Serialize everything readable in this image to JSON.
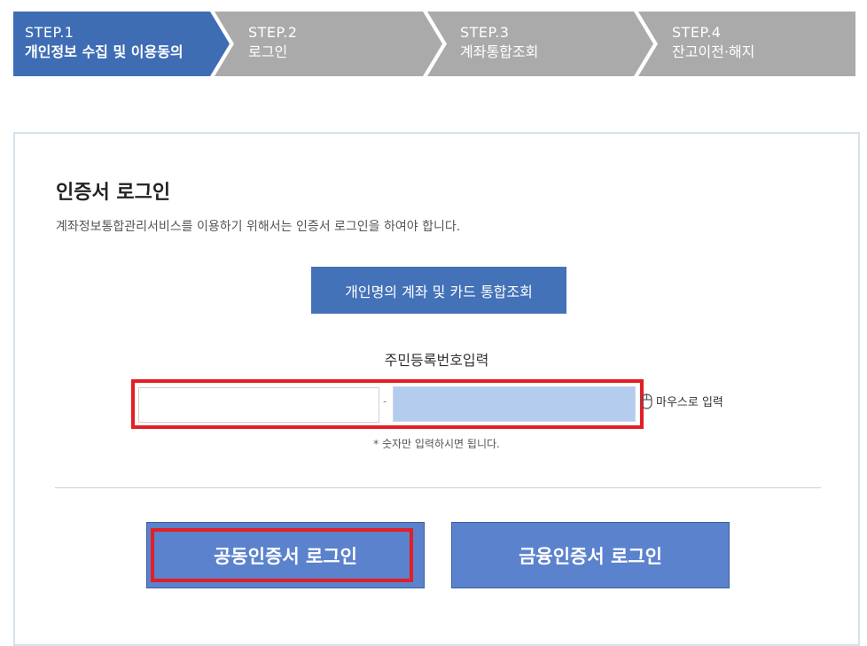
{
  "steps": [
    {
      "num": "STEP.1",
      "label": "개인정보 수집 및 이용동의",
      "active": true
    },
    {
      "num": "STEP.2",
      "label": "로그인",
      "active": false
    },
    {
      "num": "STEP.3",
      "label": "계좌통합조회",
      "active": false
    },
    {
      "num": "STEP.4",
      "label": "잔고이전·해지",
      "active": false
    }
  ],
  "colors": {
    "active_step": "#3f6db4",
    "inactive_step": "#aaaaaa",
    "button_blue": "#5b82cc",
    "highlight_red": "#e21f26",
    "input_focus": "#b4cdee"
  },
  "login": {
    "title": "인증서 로그인",
    "description": "계좌정보통합관리서비스를 이용하기 위해서는 인증서 로그인을 하여야 합니다.",
    "inquiry_button": "개인명의 계좌 및 카드 통합조회",
    "rrn_label": "주민등록번호입력",
    "rrn_first": {
      "value": "",
      "placeholder": ""
    },
    "rrn_separator": "-",
    "rrn_second": {
      "value": "",
      "placeholder": ""
    },
    "mouse_input_label": "마우스로 입력",
    "mouse_icon": "mouse-icon",
    "hint": "* 숫자만 입력하시면 됩니다.",
    "joint_cert_button": "공동인증서 로그인",
    "financial_cert_button": "금융인증서 로그인"
  }
}
